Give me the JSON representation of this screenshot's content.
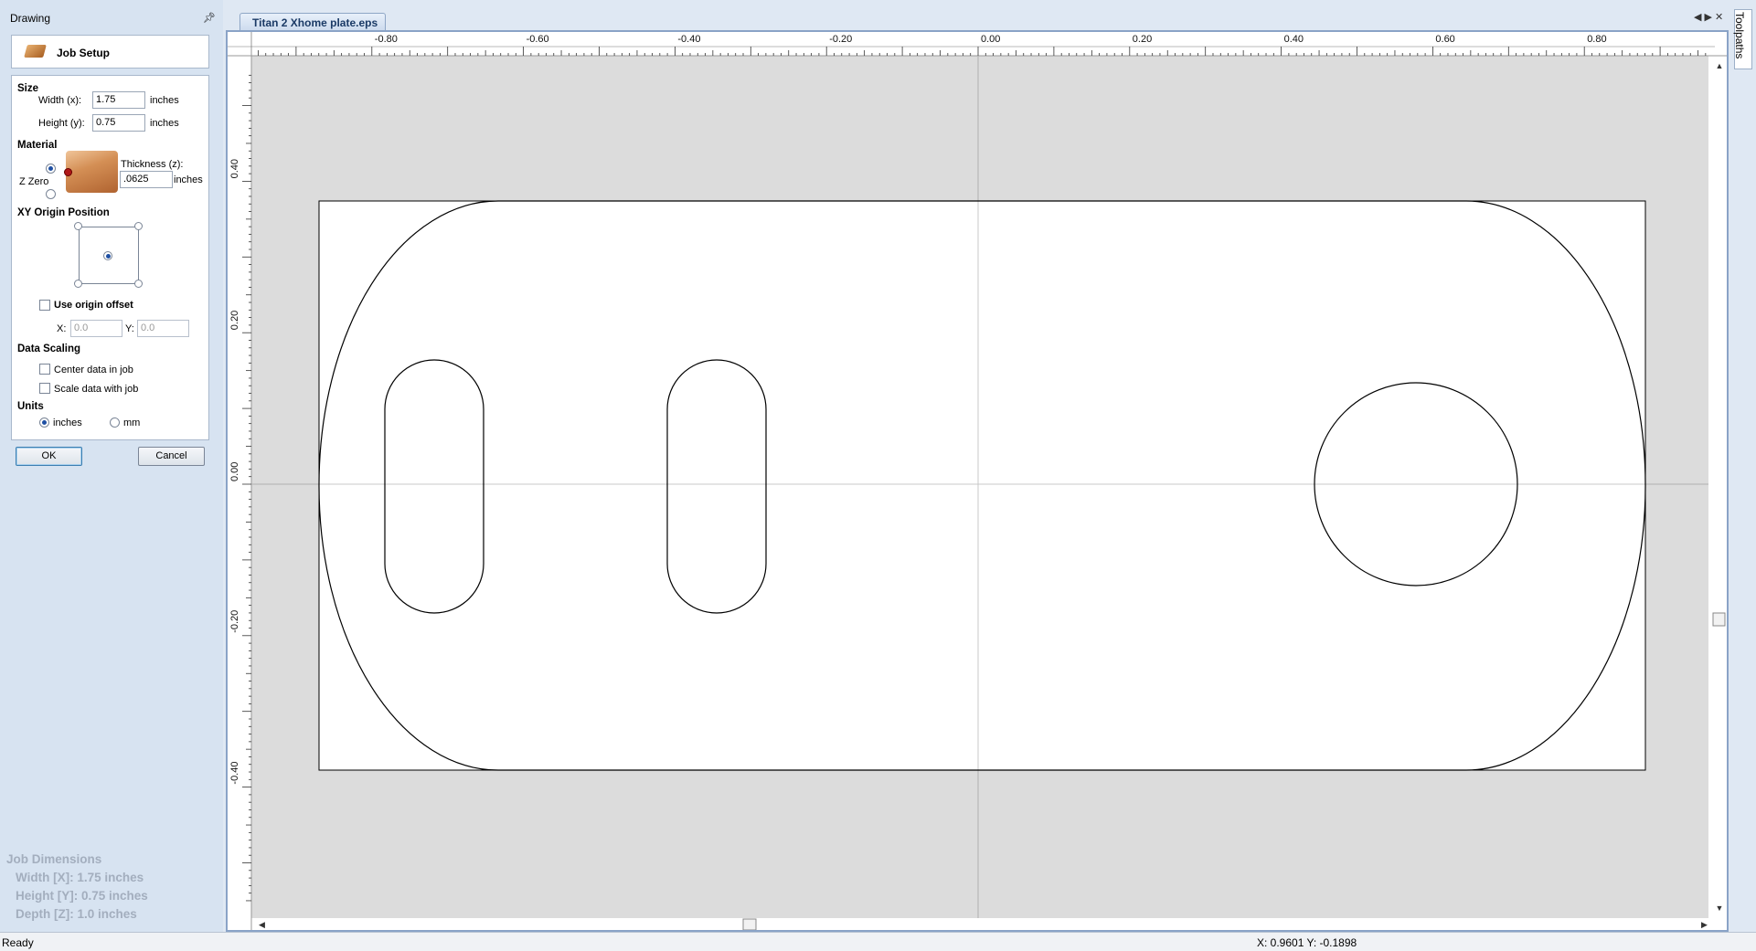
{
  "panel": {
    "title": "Drawing",
    "job_setup_title": "Job Setup",
    "size": {
      "heading": "Size",
      "width_label": "Width (x):",
      "width_value": "1.75",
      "height_label": "Height (y):",
      "height_value": "0.75",
      "unit": "inches"
    },
    "material": {
      "heading": "Material",
      "zzero_label": "Z Zero",
      "thickness_label": "Thickness (z):",
      "thickness_value": ".0625",
      "unit": "inches"
    },
    "origin": {
      "heading": "XY Origin Position",
      "use_offset_label": "Use origin offset",
      "x_label": "X:",
      "x_value": "0.0",
      "y_label": "Y:",
      "y_value": "0.0"
    },
    "scaling": {
      "heading": "Data Scaling",
      "center_label": "Center data in job",
      "scale_label": "Scale data with job"
    },
    "units": {
      "heading": "Units",
      "inches_label": "inches",
      "mm_label": "mm",
      "selected": "inches"
    },
    "ok_label": "OK",
    "cancel_label": "Cancel",
    "job_dimensions": {
      "heading": "Job Dimensions",
      "width": "Width  [X]: 1.75 inches",
      "height": "Height [Y]: 0.75 inches",
      "depth": "Depth  [Z]: 1.0 inches"
    }
  },
  "document": {
    "tab_title": "Titan 2 Xhome plate.eps",
    "right_tab": "Toolpaths",
    "ruler_x_labels": [
      "-0.80",
      "-0.60",
      "-0.40",
      "-0.20",
      "0.00",
      "0.20",
      "0.40",
      "0.60",
      "0.80"
    ],
    "ruler_x_values": [
      -0.8,
      -0.6,
      -0.4,
      -0.2,
      0.0,
      0.2,
      0.4,
      0.6,
      0.8
    ],
    "ruler_y_labels": [
      "0.40",
      "0.20",
      "0.00",
      "-0.20",
      "-0.40"
    ],
    "ruler_y_values": [
      0.4,
      0.2,
      0.0,
      -0.2,
      -0.4
    ]
  },
  "status": {
    "text": "Ready",
    "coords": "X: 0.9601 Y: -0.1898"
  },
  "colors": {
    "accent": "#1b3a66",
    "panel_bg": "#d7e3f1",
    "canvas_bg": "#dcdcdc"
  }
}
